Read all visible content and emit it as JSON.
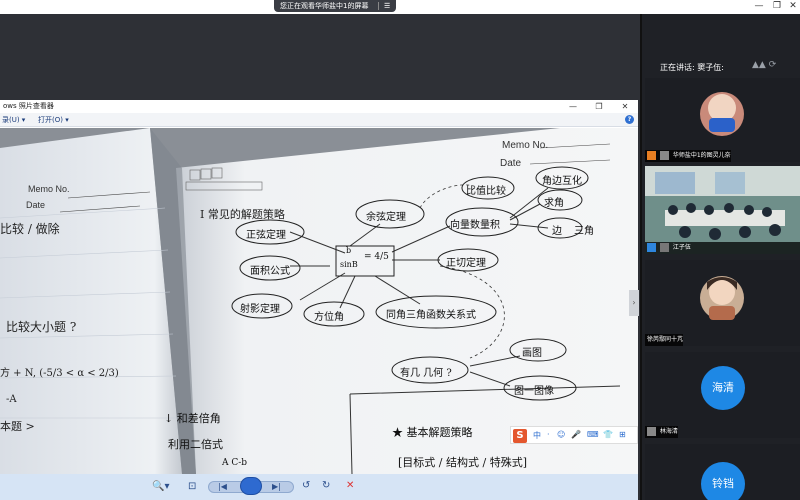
{
  "share_banner": {
    "text": "您正在观看华师盐中1的屏幕",
    "menu_icon": "list-icon"
  },
  "window_controls": {
    "minimize": "—",
    "restore": "❐",
    "close": "✕"
  },
  "viewer": {
    "title": "ows 照片查看器",
    "menu": [
      "录(U) ▾",
      "打开(O) ▾"
    ],
    "help_icon": "?",
    "controls": {
      "minimize": "—",
      "restore": "❐",
      "close": "✕"
    }
  },
  "notebook": {
    "left_page": {
      "memo_no": "Memo No.",
      "date": "Date",
      "lines": [
        "比较 / 做除",
        "比较大小题 ?",
        "方 + N, (-5/3 < α < 2/3)",
        "-A",
        "本题 >"
      ]
    },
    "right_page": {
      "memo_no": "Memo No.",
      "date": "Date",
      "heading": "I  常见的解题策略",
      "mind_map": {
        "center_top": "b",
        "center_bottom": "sinB",
        "center_right": "= 4/5",
        "nodes": [
          "正弦定理",
          "余弦定理",
          "面积公式",
          "正切定理",
          "向量数量积",
          "比值比较",
          "射影定理",
          "同角三角函数关系式",
          "方位角"
        ],
        "top_right": [
          "角边互化",
          "求角",
          "边"
        ],
        "right_nodes": [
          "三角"
        ],
        "bottom_question": "有几 几何 ?",
        "bottom_right": [
          "画图",
          "图一图像"
        ],
        "list_heading": "★ 基本解题策略",
        "list_line": "[目标式 / 结构式 / 特殊式]",
        "left_bottom": [
          "↓ 和差倍角",
          "利用二倍式",
          "A   C-b"
        ]
      }
    }
  },
  "ime_bar": {
    "logo": "S",
    "items": [
      "中",
      "·",
      "☺",
      "🎤",
      "⌨",
      "👕",
      "⊞"
    ]
  },
  "viewer_toolbar": {
    "zoom": "🔍▾",
    "fit": "⊡",
    "prev": "|◀",
    "next": "▶|",
    "rotate_ccw": "↺",
    "rotate_cw": "↻",
    "delete": "✕"
  },
  "sidebar": {
    "speaking_label": "正在讲话: 窦子伍:",
    "participants": [
      {
        "name": "华师盐中1的图灵儿奈",
        "avatar": "cartoon-avatar"
      },
      {
        "name": "江子伍",
        "avatar": "classroom-video"
      },
      {
        "name": "徐芮鄢同十芃",
        "avatar": "student-photo"
      },
      {
        "name": "林海清",
        "avatar_text": "海清",
        "color": "#1e88e5"
      },
      {
        "name": "铃铛",
        "avatar_text": "铃铛",
        "color": "#1e88e5"
      }
    ]
  }
}
